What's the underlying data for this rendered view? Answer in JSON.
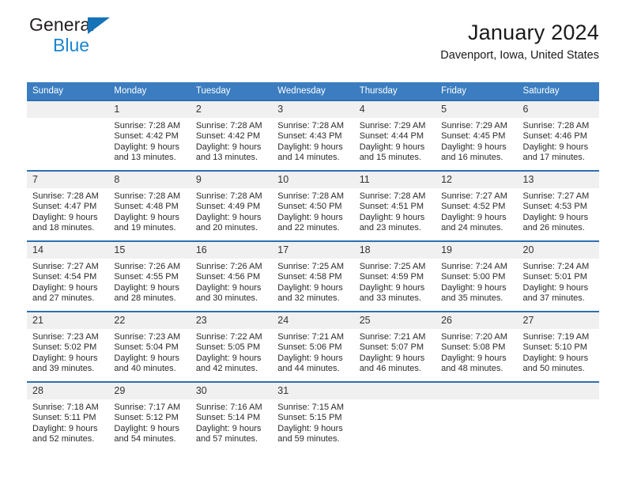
{
  "brand": {
    "name_top": "General",
    "name_bottom": "Blue",
    "accent_color": "#1673b8"
  },
  "header": {
    "title": "January 2024",
    "subtitle": "Davenport, Iowa, United States"
  },
  "theme": {
    "header_bg": "#3b7dc0",
    "row_divider": "#2f6fb0",
    "daynum_bg": "#f0f0f0"
  },
  "weekdays": [
    "Sunday",
    "Monday",
    "Tuesday",
    "Wednesday",
    "Thursday",
    "Friday",
    "Saturday"
  ],
  "weeks": [
    [
      {
        "day": "",
        "sunrise": "",
        "sunset": "",
        "daylight": ""
      },
      {
        "day": "1",
        "sunrise": "Sunrise: 7:28 AM",
        "sunset": "Sunset: 4:42 PM",
        "daylight": "Daylight: 9 hours and 13 minutes."
      },
      {
        "day": "2",
        "sunrise": "Sunrise: 7:28 AM",
        "sunset": "Sunset: 4:42 PM",
        "daylight": "Daylight: 9 hours and 13 minutes."
      },
      {
        "day": "3",
        "sunrise": "Sunrise: 7:28 AM",
        "sunset": "Sunset: 4:43 PM",
        "daylight": "Daylight: 9 hours and 14 minutes."
      },
      {
        "day": "4",
        "sunrise": "Sunrise: 7:29 AM",
        "sunset": "Sunset: 4:44 PM",
        "daylight": "Daylight: 9 hours and 15 minutes."
      },
      {
        "day": "5",
        "sunrise": "Sunrise: 7:29 AM",
        "sunset": "Sunset: 4:45 PM",
        "daylight": "Daylight: 9 hours and 16 minutes."
      },
      {
        "day": "6",
        "sunrise": "Sunrise: 7:28 AM",
        "sunset": "Sunset: 4:46 PM",
        "daylight": "Daylight: 9 hours and 17 minutes."
      }
    ],
    [
      {
        "day": "7",
        "sunrise": "Sunrise: 7:28 AM",
        "sunset": "Sunset: 4:47 PM",
        "daylight": "Daylight: 9 hours and 18 minutes."
      },
      {
        "day": "8",
        "sunrise": "Sunrise: 7:28 AM",
        "sunset": "Sunset: 4:48 PM",
        "daylight": "Daylight: 9 hours and 19 minutes."
      },
      {
        "day": "9",
        "sunrise": "Sunrise: 7:28 AM",
        "sunset": "Sunset: 4:49 PM",
        "daylight": "Daylight: 9 hours and 20 minutes."
      },
      {
        "day": "10",
        "sunrise": "Sunrise: 7:28 AM",
        "sunset": "Sunset: 4:50 PM",
        "daylight": "Daylight: 9 hours and 22 minutes."
      },
      {
        "day": "11",
        "sunrise": "Sunrise: 7:28 AM",
        "sunset": "Sunset: 4:51 PM",
        "daylight": "Daylight: 9 hours and 23 minutes."
      },
      {
        "day": "12",
        "sunrise": "Sunrise: 7:27 AM",
        "sunset": "Sunset: 4:52 PM",
        "daylight": "Daylight: 9 hours and 24 minutes."
      },
      {
        "day": "13",
        "sunrise": "Sunrise: 7:27 AM",
        "sunset": "Sunset: 4:53 PM",
        "daylight": "Daylight: 9 hours and 26 minutes."
      }
    ],
    [
      {
        "day": "14",
        "sunrise": "Sunrise: 7:27 AM",
        "sunset": "Sunset: 4:54 PM",
        "daylight": "Daylight: 9 hours and 27 minutes."
      },
      {
        "day": "15",
        "sunrise": "Sunrise: 7:26 AM",
        "sunset": "Sunset: 4:55 PM",
        "daylight": "Daylight: 9 hours and 28 minutes."
      },
      {
        "day": "16",
        "sunrise": "Sunrise: 7:26 AM",
        "sunset": "Sunset: 4:56 PM",
        "daylight": "Daylight: 9 hours and 30 minutes."
      },
      {
        "day": "17",
        "sunrise": "Sunrise: 7:25 AM",
        "sunset": "Sunset: 4:58 PM",
        "daylight": "Daylight: 9 hours and 32 minutes."
      },
      {
        "day": "18",
        "sunrise": "Sunrise: 7:25 AM",
        "sunset": "Sunset: 4:59 PM",
        "daylight": "Daylight: 9 hours and 33 minutes."
      },
      {
        "day": "19",
        "sunrise": "Sunrise: 7:24 AM",
        "sunset": "Sunset: 5:00 PM",
        "daylight": "Daylight: 9 hours and 35 minutes."
      },
      {
        "day": "20",
        "sunrise": "Sunrise: 7:24 AM",
        "sunset": "Sunset: 5:01 PM",
        "daylight": "Daylight: 9 hours and 37 minutes."
      }
    ],
    [
      {
        "day": "21",
        "sunrise": "Sunrise: 7:23 AM",
        "sunset": "Sunset: 5:02 PM",
        "daylight": "Daylight: 9 hours and 39 minutes."
      },
      {
        "day": "22",
        "sunrise": "Sunrise: 7:23 AM",
        "sunset": "Sunset: 5:04 PM",
        "daylight": "Daylight: 9 hours and 40 minutes."
      },
      {
        "day": "23",
        "sunrise": "Sunrise: 7:22 AM",
        "sunset": "Sunset: 5:05 PM",
        "daylight": "Daylight: 9 hours and 42 minutes."
      },
      {
        "day": "24",
        "sunrise": "Sunrise: 7:21 AM",
        "sunset": "Sunset: 5:06 PM",
        "daylight": "Daylight: 9 hours and 44 minutes."
      },
      {
        "day": "25",
        "sunrise": "Sunrise: 7:21 AM",
        "sunset": "Sunset: 5:07 PM",
        "daylight": "Daylight: 9 hours and 46 minutes."
      },
      {
        "day": "26",
        "sunrise": "Sunrise: 7:20 AM",
        "sunset": "Sunset: 5:08 PM",
        "daylight": "Daylight: 9 hours and 48 minutes."
      },
      {
        "day": "27",
        "sunrise": "Sunrise: 7:19 AM",
        "sunset": "Sunset: 5:10 PM",
        "daylight": "Daylight: 9 hours and 50 minutes."
      }
    ],
    [
      {
        "day": "28",
        "sunrise": "Sunrise: 7:18 AM",
        "sunset": "Sunset: 5:11 PM",
        "daylight": "Daylight: 9 hours and 52 minutes."
      },
      {
        "day": "29",
        "sunrise": "Sunrise: 7:17 AM",
        "sunset": "Sunset: 5:12 PM",
        "daylight": "Daylight: 9 hours and 54 minutes."
      },
      {
        "day": "30",
        "sunrise": "Sunrise: 7:16 AM",
        "sunset": "Sunset: 5:14 PM",
        "daylight": "Daylight: 9 hours and 57 minutes."
      },
      {
        "day": "31",
        "sunrise": "Sunrise: 7:15 AM",
        "sunset": "Sunset: 5:15 PM",
        "daylight": "Daylight: 9 hours and 59 minutes."
      },
      {
        "day": "",
        "sunrise": "",
        "sunset": "",
        "daylight": ""
      },
      {
        "day": "",
        "sunrise": "",
        "sunset": "",
        "daylight": ""
      },
      {
        "day": "",
        "sunrise": "",
        "sunset": "",
        "daylight": ""
      }
    ]
  ]
}
